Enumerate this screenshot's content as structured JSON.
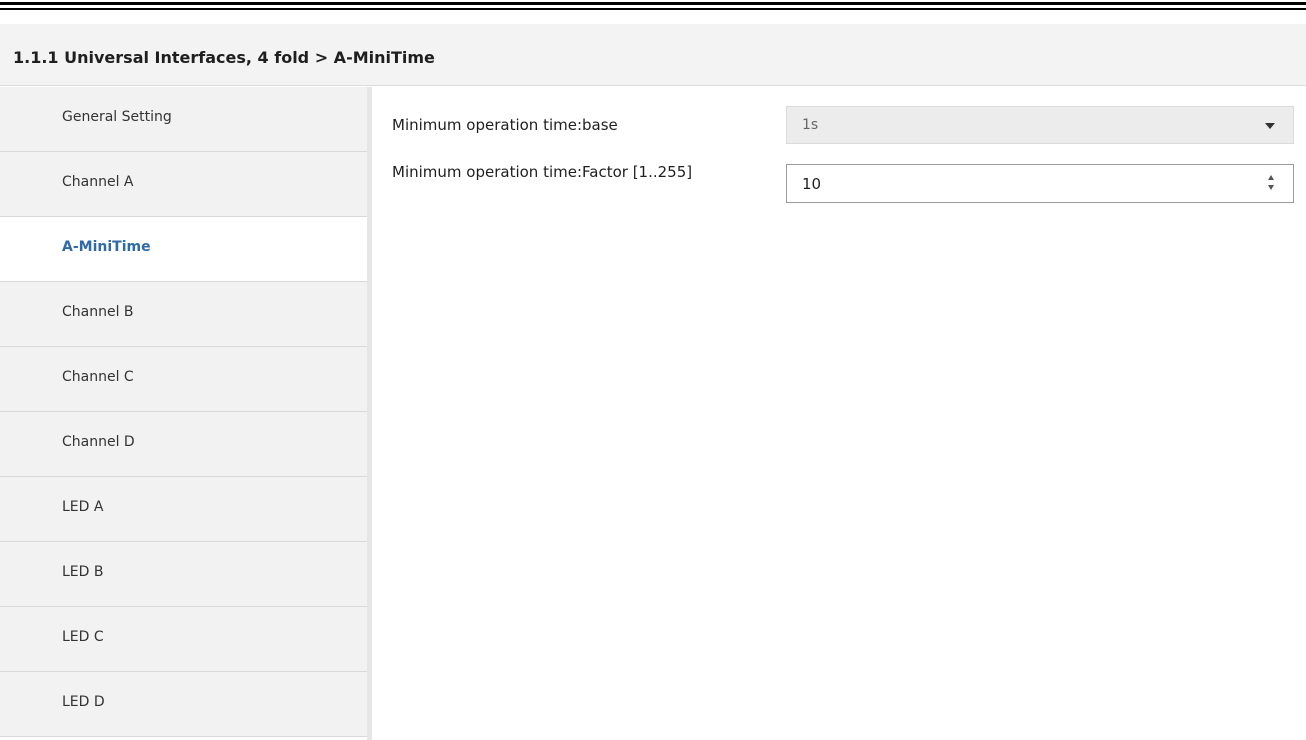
{
  "header": {
    "title": "1.1.1 Universal Interfaces, 4 fold > A-MiniTime"
  },
  "sidebar": {
    "items": [
      {
        "label": "General Setting"
      },
      {
        "label": "Channel A"
      },
      {
        "label": "A-MiniTime",
        "active": true
      },
      {
        "label": "Channel B"
      },
      {
        "label": "Channel C"
      },
      {
        "label": "Channel D"
      },
      {
        "label": "LED A"
      },
      {
        "label": "LED B"
      },
      {
        "label": "LED C"
      },
      {
        "label": "LED D"
      }
    ]
  },
  "params": {
    "base": {
      "label": "Minimum operation time:base",
      "value": "1s"
    },
    "factor": {
      "label": "Minimum operation time:Factor [1..255]",
      "value": "10"
    }
  },
  "colors": {
    "active_item_text": "#2d6aa6",
    "header_bg": "#f3f3f3"
  }
}
